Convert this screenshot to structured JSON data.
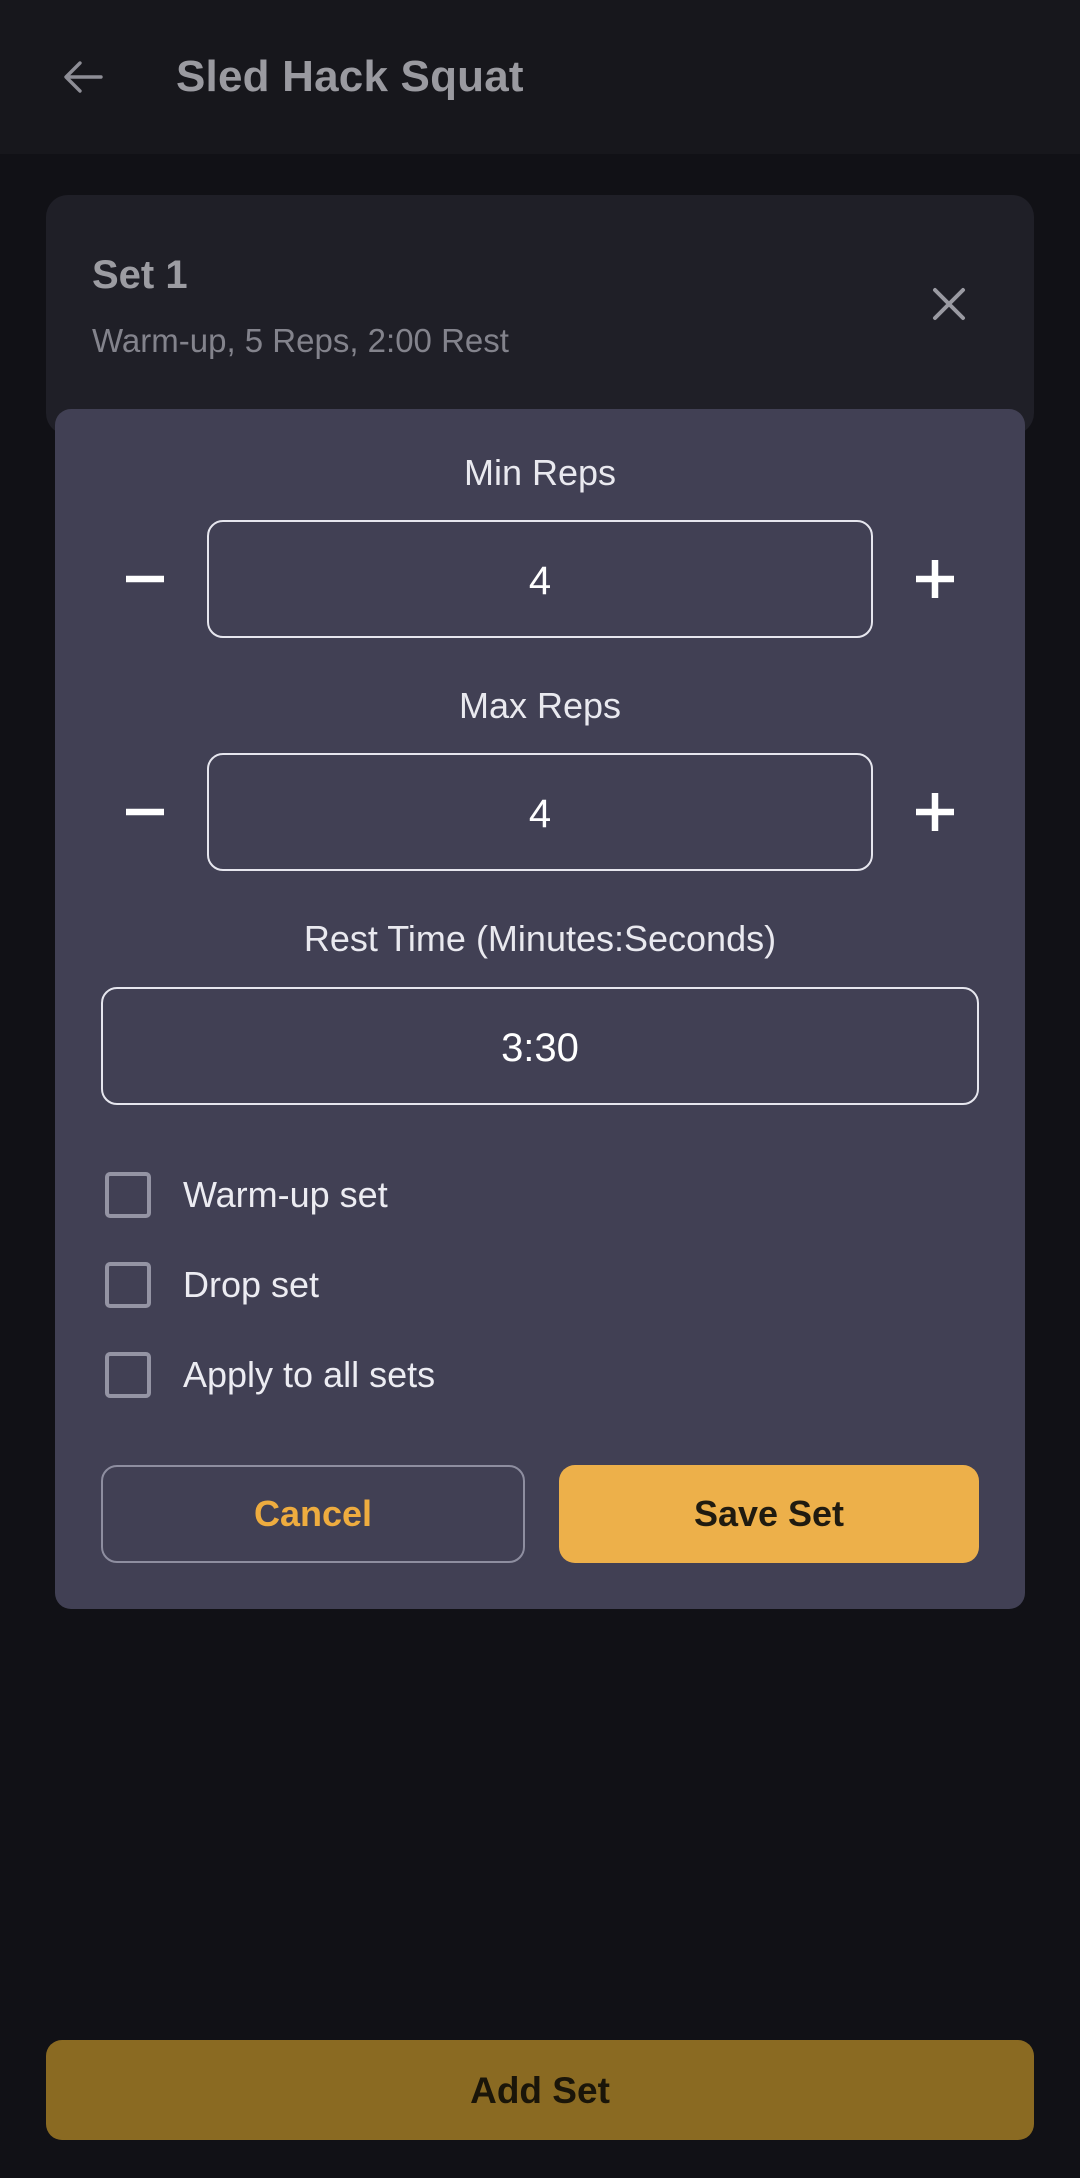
{
  "appbar": {
    "back_icon": "arrow-left-icon",
    "title": "Sled Hack Squat"
  },
  "set_card": {
    "title": "Set 1",
    "subtitle": "Warm-up, 5 Reps, 2:00 Rest",
    "close_icon": "close-icon"
  },
  "edit_panel": {
    "min_reps": {
      "label": "Min Reps",
      "value": "4",
      "decrement_icon": "minus-icon",
      "increment_icon": "plus-icon"
    },
    "max_reps": {
      "label": "Max Reps",
      "value": "4",
      "decrement_icon": "minus-icon",
      "increment_icon": "plus-icon"
    },
    "rest_time": {
      "label": "Rest Time (Minutes:Seconds)",
      "value": "3:30"
    },
    "checkboxes": [
      {
        "label": "Warm-up set",
        "checked": false
      },
      {
        "label": "Drop set",
        "checked": false
      },
      {
        "label": "Apply to all sets",
        "checked": false
      }
    ],
    "cancel_label": "Cancel",
    "save_label": "Save Set"
  },
  "bottom": {
    "add_set_label": "Add Set"
  },
  "colors": {
    "accent": "#edb04a",
    "accent_muted": "#8a6a22",
    "panel": "#414054",
    "card": "#1f1f27",
    "background": "#111116",
    "appbar": "#17171c"
  }
}
